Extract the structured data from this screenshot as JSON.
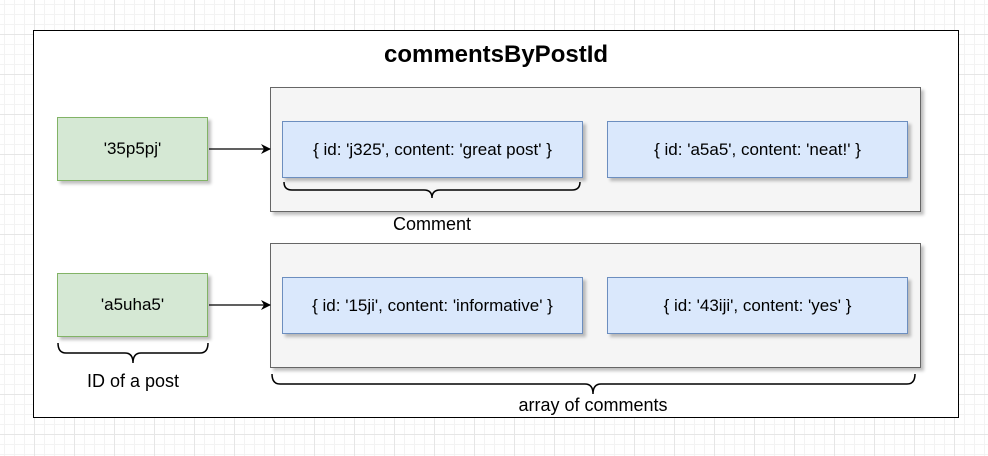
{
  "diagram": {
    "title": "commentsByPostId",
    "rows": [
      {
        "key": "'35p5pj'",
        "comments": [
          "{ id: 'j325', content: 'great post' }",
          "{ id: 'a5a5', content: 'neat!' }"
        ]
      },
      {
        "key": "'a5uha5'",
        "comments": [
          "{ id: '15ji', content: 'informative' }",
          "{ id: '43iji', content: 'yes' }"
        ]
      }
    ],
    "labels": {
      "comment": "Comment",
      "post_id": "ID of a post",
      "array": "array of comments"
    }
  }
}
